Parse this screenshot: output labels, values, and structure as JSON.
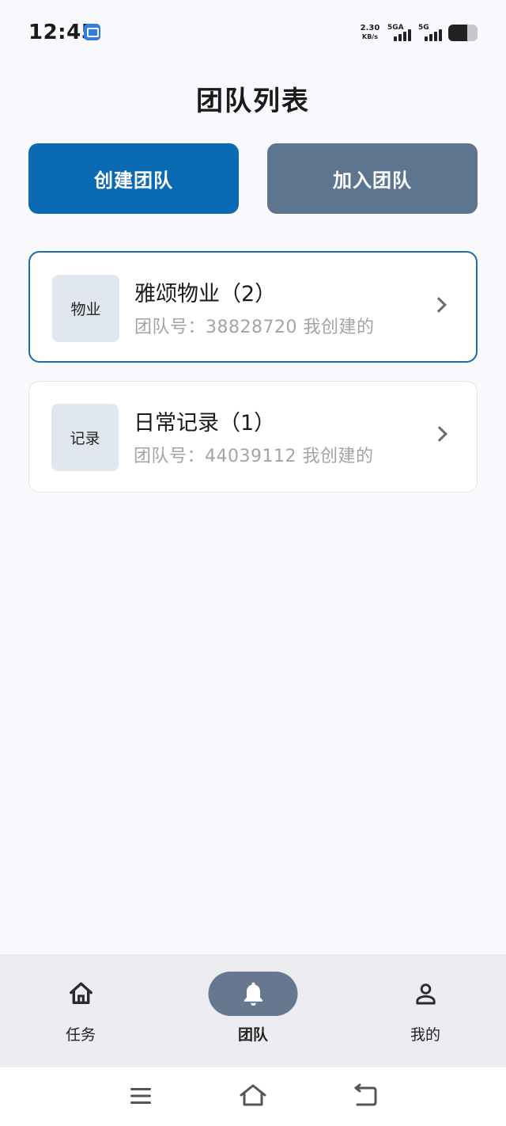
{
  "status_bar": {
    "time": "12:45",
    "net_speed_value": "2.30",
    "net_speed_unit": "KB/s",
    "sim1_label": "5GA",
    "sim2_label": "5G",
    "battery_level": 0.65
  },
  "page": {
    "title": "团队列表"
  },
  "actions": {
    "create_label": "创建团队",
    "join_label": "加入团队"
  },
  "teams": [
    {
      "thumb": "物业",
      "name": "雅颂物业（2）",
      "meta": "团队号：38828720 我创建的",
      "selected": true
    },
    {
      "thumb": "记录",
      "name": "日常记录（1）",
      "meta": "团队号：44039112 我创建的",
      "selected": false
    }
  ],
  "bottom_nav": {
    "items": [
      {
        "label": "任务",
        "icon": "home-icon"
      },
      {
        "label": "团队",
        "icon": "bell-icon",
        "active": true
      },
      {
        "label": "我的",
        "icon": "person-icon"
      }
    ]
  },
  "colors": {
    "primary": "#0b6ab4",
    "secondary": "#5e7590",
    "selected_border": "#1f6e9e",
    "background": "#f8f8fd"
  }
}
